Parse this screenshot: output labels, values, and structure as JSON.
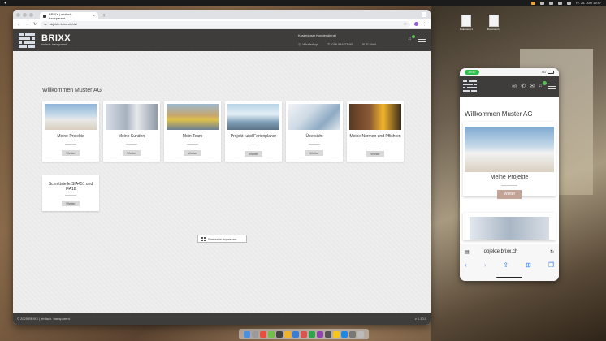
{
  "desktop": {
    "menubar_clock": "Fr. 28. Juni  19:47",
    "files": [
      {
        "label": "Dokument 1"
      },
      {
        "label": "Dokument 2"
      }
    ]
  },
  "browser": {
    "tab_title": "BRIXX | einfach. transparent.",
    "new_tab": "+",
    "url": "objekte.brixx.ch/de/",
    "colors": {
      "header": "#3f3d3b",
      "page_bg": "#eeeeee"
    }
  },
  "site": {
    "brand": "BRIXX",
    "tagline": "einfach. transparent.",
    "contact_title": "Kostenloser Kundendienst",
    "contact_whatsapp": "WhatsApp",
    "contact_phone": "079 544 27 60",
    "contact_email": "E-Mail",
    "welcome": "Willkommen Muster AG",
    "cards": [
      {
        "label": "Meine Projekte",
        "button": "Weiter",
        "icon": "construction-workers-photo"
      },
      {
        "label": "Meine Kunden",
        "button": "Weiter",
        "icon": "handshake-photo"
      },
      {
        "label": "Mein Team",
        "button": "Weiter",
        "icon": "team-helmets-photo"
      },
      {
        "label": "Projekt- und Ferienplaner",
        "button": "Weiter",
        "icon": "office-glass-photo"
      },
      {
        "label": "Übersicht",
        "button": "Weiter",
        "icon": "documents-magnifier-photo"
      },
      {
        "label": "Meine Normen und Pflichten",
        "button": "Weiter",
        "icon": "gavel-helmet-photo"
      },
      {
        "label": "Schnittstelle SIA451 und IFA18",
        "button": "Weiter"
      }
    ],
    "customize_button": "Startseite anpassen",
    "footer_left": "© 2025 BRIXX | einfach. transparent.",
    "footer_right": "v 1.10.0"
  },
  "phone": {
    "time": "19:47",
    "network": "4G",
    "welcome": "Willkommen Muster AG",
    "card_label": "Meine Projekte",
    "card_button": "Weiter",
    "url": "objekte.brixx.ch",
    "accent": "#c4a497"
  }
}
